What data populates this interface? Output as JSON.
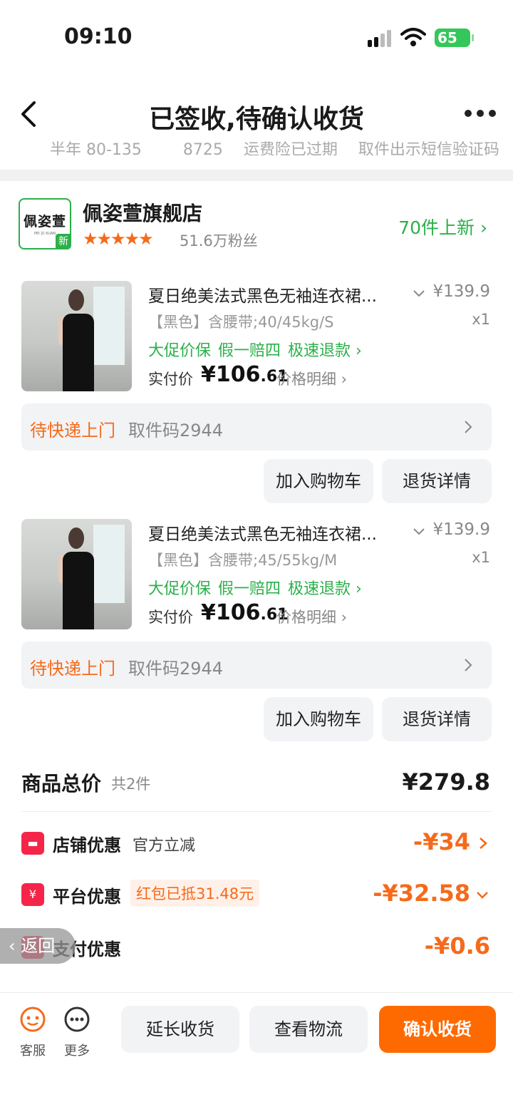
{
  "status_bar": {
    "time": "09:10",
    "battery": "65"
  },
  "nav": {
    "title": "已签收,待确认收货"
  },
  "peek_row": {
    "text": "半年 80-135 　　 8725 　运费险已过期 　取件出示短信验证码"
  },
  "store": {
    "logo_cn": "佩姿萱",
    "logo_en": "PEI ZI XUAN",
    "logo_badge": "新",
    "name": "佩姿萱旗舰店",
    "stars": "★★★★★",
    "rating": 4.5,
    "fans": "51.6万粉丝",
    "new_arrivals": "70件上新 ›"
  },
  "items": [
    {
      "title": "夏日绝美法式黑色无袖连衣裙...",
      "price": "¥139.9",
      "spec": "【黑色】含腰带;40/45kg/S",
      "qty": "x1",
      "tags": [
        "大促价保",
        "假一赔四",
        "极速退款 ›"
      ],
      "paid_label": "实付价",
      "paid_main": "¥106",
      "paid_cents": ".61",
      "detail_link": "价格明细 ›",
      "pickup_status": "待快递上门",
      "pickup_code": "取件码2944",
      "btn_cart": "加入购物车",
      "btn_refund": "退货详情"
    },
    {
      "title": "夏日绝美法式黑色无袖连衣裙...",
      "price": "¥139.9",
      "spec": "【黑色】含腰带;45/55kg/M",
      "qty": "x1",
      "tags": [
        "大促价保",
        "假一赔四",
        "极速退款 ›"
      ],
      "paid_label": "实付价",
      "paid_main": "¥106",
      "paid_cents": ".61",
      "detail_link": "价格明细 ›",
      "pickup_status": "待快递上门",
      "pickup_code": "取件码2944",
      "btn_cart": "加入购物车",
      "btn_refund": "退货详情"
    }
  ],
  "summary": {
    "title": "商品总价",
    "count": "共2件",
    "total": "¥279.8",
    "discounts": [
      {
        "label": "店铺优惠",
        "sub": "官方立减",
        "amount": "-¥34"
      },
      {
        "label": "平台优惠",
        "sub": "红包已抵31.48元",
        "amount": "-¥32.58"
      },
      {
        "label": "支付优惠",
        "amount": "-¥0.6"
      }
    ]
  },
  "back_float": "返回",
  "bottom_bar": {
    "service_label": "客服",
    "more_label": "更多",
    "extend_label": "延长收货",
    "logistics_label": "查看物流",
    "confirm_label": "确认收货"
  },
  "colors": {
    "accent": "#ff6a00",
    "green": "#2bb04a",
    "orange_text": "#f56a1a"
  }
}
